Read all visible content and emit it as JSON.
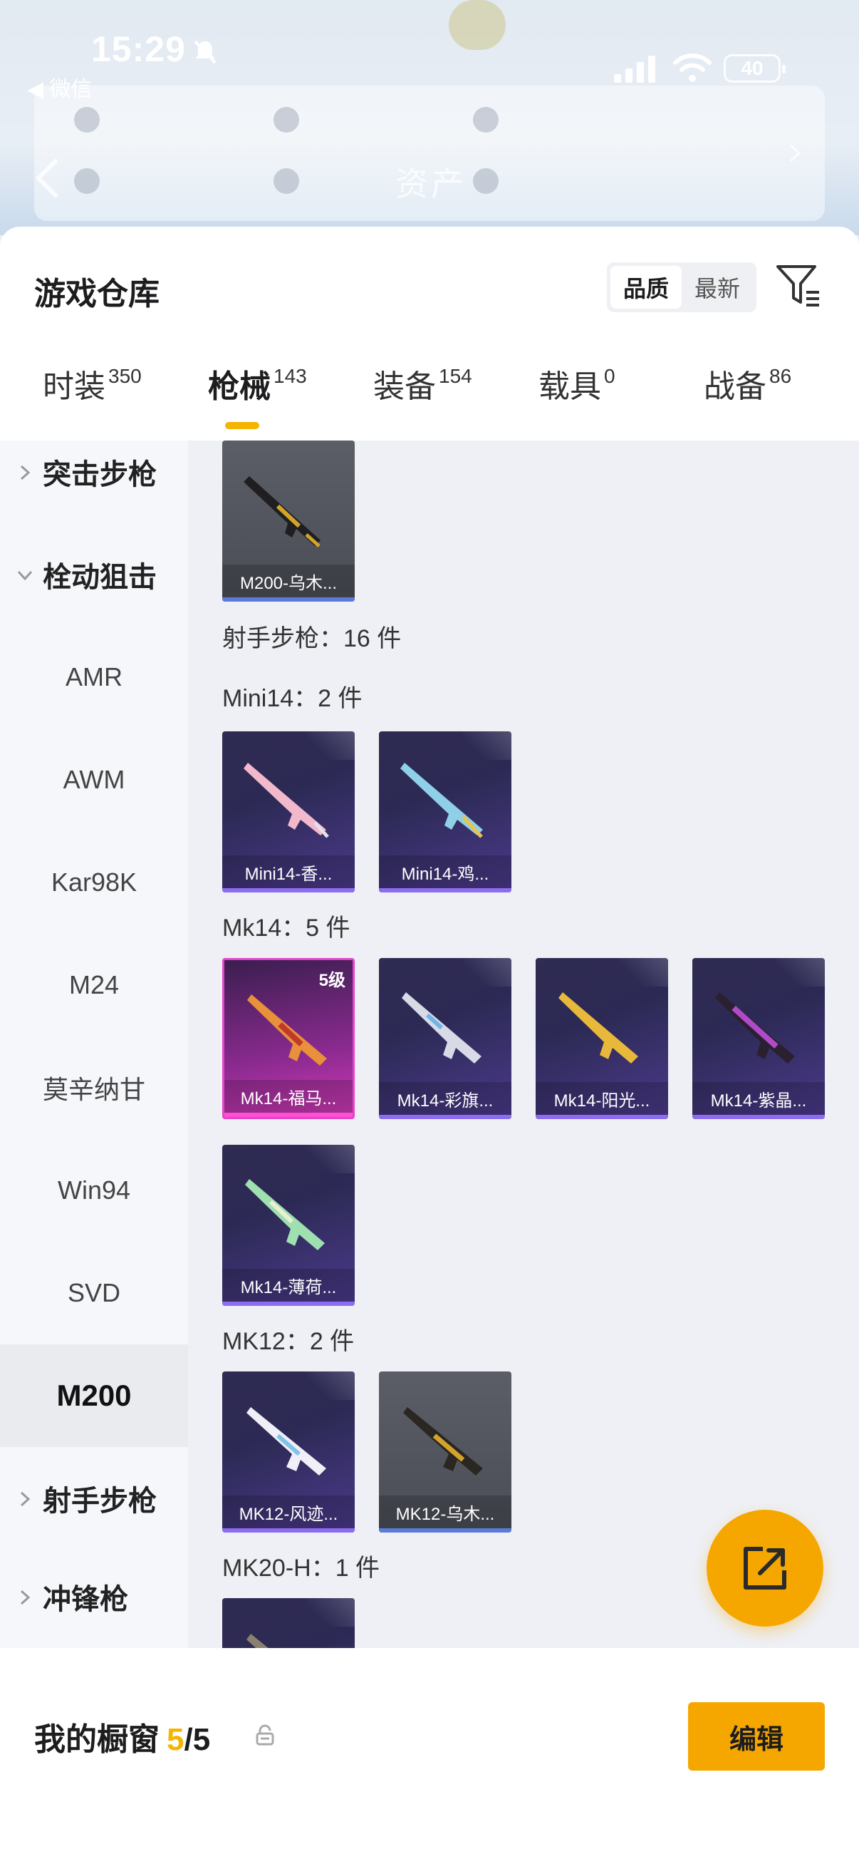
{
  "status_bar": {
    "time": "15:29",
    "back_app": "◀ 微信",
    "battery": "40"
  },
  "background": {
    "title": "资产"
  },
  "sheet": {
    "title": "游戏仓库"
  },
  "sort": {
    "options": [
      "品质",
      "最新"
    ],
    "active": "品质"
  },
  "tabs": [
    {
      "label": "时装",
      "count": "350"
    },
    {
      "label": "枪械",
      "count": "143",
      "active": true
    },
    {
      "label": "装备",
      "count": "154"
    },
    {
      "label": "载具",
      "count": "0"
    },
    {
      "label": "战备",
      "count": "86"
    }
  ],
  "categories": [
    {
      "label": "突击步枪",
      "type": "group",
      "state": "collapsed"
    },
    {
      "label": "栓动狙击",
      "type": "group",
      "state": "expanded"
    },
    {
      "label": "AMR"
    },
    {
      "label": "AWM"
    },
    {
      "label": "Kar98K"
    },
    {
      "label": "M24"
    },
    {
      "label": "莫辛纳甘"
    },
    {
      "label": "Win94"
    },
    {
      "label": "SVD"
    },
    {
      "label": "M200",
      "selected": true
    },
    {
      "label": "射手步枪",
      "type": "group",
      "state": "collapsed"
    },
    {
      "label": "冲锋枪",
      "type": "group",
      "state": "collapsed"
    }
  ],
  "content": {
    "section_label": "射手步枪：16 件",
    "groups": [
      {
        "label": "Mini14：2 件"
      },
      {
        "label": "Mk14：5 件"
      },
      {
        "label": "MK12：2 件"
      },
      {
        "label": "MK20-H：1 件"
      }
    ],
    "items": [
      {
        "name": "M200-乌木...",
        "rarity": "gray"
      },
      {
        "name": "Mini14-香...",
        "rarity": "purple"
      },
      {
        "name": "Mini14-鸡...",
        "rarity": "purple"
      },
      {
        "name": "Mk14-福马...",
        "rarity": "pink",
        "level": "5级"
      },
      {
        "name": "Mk14-彩旗...",
        "rarity": "purple"
      },
      {
        "name": "Mk14-阳光...",
        "rarity": "purple"
      },
      {
        "name": "Mk14-紫晶...",
        "rarity": "purple"
      },
      {
        "name": "Mk14-薄荷...",
        "rarity": "purple"
      },
      {
        "name": "MK12-风迹...",
        "rarity": "purple"
      },
      {
        "name": "MK12-乌木...",
        "rarity": "gray"
      },
      {
        "name": "",
        "rarity": "purple"
      }
    ]
  },
  "showcase": {
    "label": "我的橱窗",
    "current": "5",
    "total": "/5"
  },
  "edit_label": "编辑",
  "colors": {
    "accent": "#f5a700",
    "rarity_purple": "#8c6cf0",
    "rarity_pink": "#e543cc"
  }
}
